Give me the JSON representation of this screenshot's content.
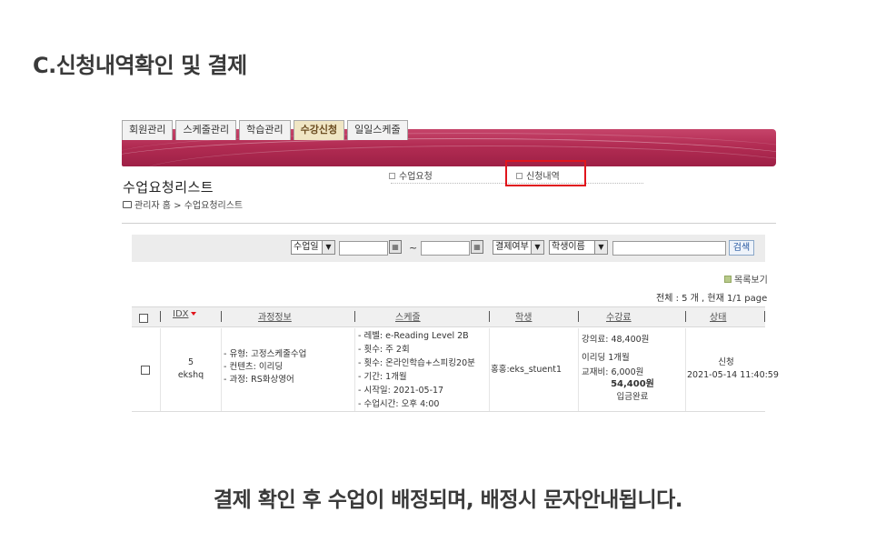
{
  "heading": "C.신청내역확인 및 결제",
  "tabs": [
    "회원관리",
    "스케줄관리",
    "학습관리",
    "수강신청",
    "일일스케줄"
  ],
  "active_tab": "수강신청",
  "submenu": [
    "수업요청",
    "신청내역"
  ],
  "page_title": "수업요청리스트",
  "breadcrumb": "관리자 홈 > 수업요청리스트",
  "search": {
    "date_select": "수업일",
    "tilde": "~",
    "payment_select": "결제여부",
    "name_select": "학생이름",
    "button": "검색",
    "calendar_glyph": "▦",
    "arrow_glyph": "▼"
  },
  "list_view": "목록보기",
  "count_text": "전체 : 5 개  ,  현재 1/1 page",
  "table": {
    "headers": [
      "IDX",
      "과정정보",
      "스케줄",
      "학생",
      "수강료",
      "상태"
    ],
    "row": {
      "idx": "5",
      "id": "ekshq",
      "course": [
        "- 유형: 고정스케줄수업",
        "- 컨텐츠: 이리딩",
        "- 과정: RS화상영어"
      ],
      "schedule": [
        "- 레벨: e-Reading Level 2B",
        "- 횟수: 주 2회",
        "- 횟수: 온라인학습+스피킹20분",
        "- 기간: 1개월",
        "- 시작일: 2021-05-17",
        "- 수업시간: 오후 4:00"
      ],
      "student": "홍홍:eks_stuent1",
      "fee_lines": [
        "강의료: 48,400원",
        "이리딩 1개월",
        "교재비: 6,000원"
      ],
      "total": "54,400원",
      "paid": "입금완료",
      "status": "신청",
      "datetime": "2021-05-14 11:40:59"
    }
  },
  "caption": "결제 확인 후 수업이 배정되며, 배정시 문자안내됩니다.",
  "colors": {
    "banner": "#b22c53",
    "highlight": "#e0141c",
    "active_tab": "#f0e6c4"
  }
}
